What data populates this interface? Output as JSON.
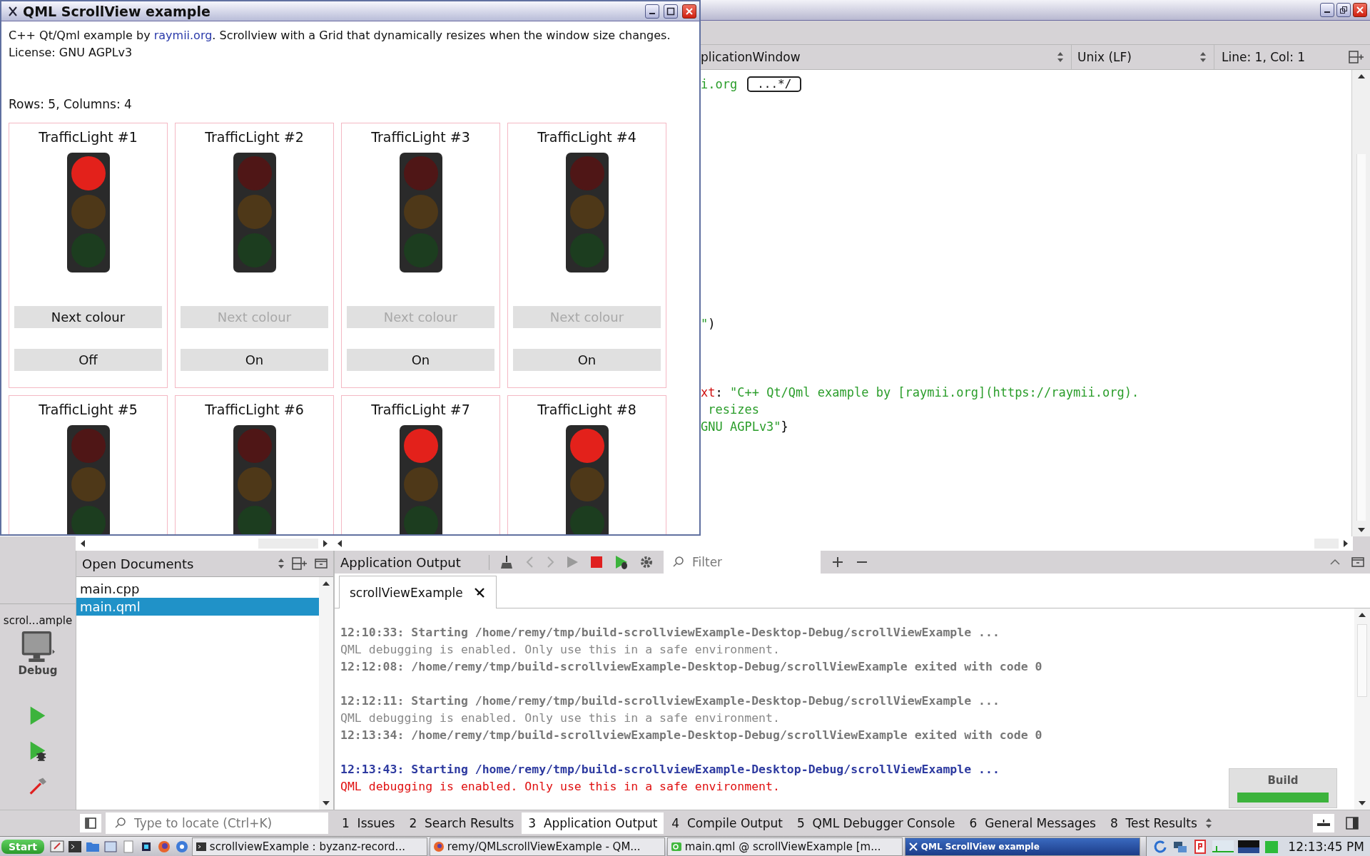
{
  "qml_window": {
    "title": "QML ScrollView example",
    "intro": {
      "before": "C++ Qt/Qml example by ",
      "link": "raymii.org",
      "after": ". Scrollview with a Grid that dynamically resizes when the window size changes."
    },
    "license": "License: GNU AGPLv3",
    "grid_info": "Rows: 5, Columns: 4",
    "lights": [
      {
        "title": "TrafficLight #1",
        "red_lit": true,
        "next_button": {
          "label": "Next colour",
          "disabled": false
        },
        "power_button": {
          "label": "Off"
        }
      },
      {
        "title": "TrafficLight #2",
        "red_lit": false,
        "next_button": {
          "label": "Next colour",
          "disabled": true
        },
        "power_button": {
          "label": "On"
        }
      },
      {
        "title": "TrafficLight #3",
        "red_lit": false,
        "next_button": {
          "label": "Next colour",
          "disabled": true
        },
        "power_button": {
          "label": "On"
        }
      },
      {
        "title": "TrafficLight #4",
        "red_lit": false,
        "next_button": {
          "label": "Next colour",
          "disabled": true
        },
        "power_button": {
          "label": "On"
        }
      },
      {
        "title": "TrafficLight #5",
        "red_lit": false
      },
      {
        "title": "TrafficLight #6",
        "red_lit": false
      },
      {
        "title": "TrafficLight #7",
        "red_lit": true
      },
      {
        "title": "TrafficLight #8",
        "red_lit": true
      }
    ]
  },
  "ide": {
    "editor_bar": {
      "document_type": "plicationWindow",
      "line_ending": "Unix (LF)",
      "cursor": "Line: 1, Col: 1"
    },
    "code_lines": [
      {
        "parts": [
          {
            "text": "i.org",
            "kind": "string"
          },
          {
            "text": "...*/",
            "kind": "fold"
          }
        ]
      },
      {
        "parts": [
          {
            "text": "\"",
            "kind": "string"
          },
          {
            "text": ")",
            "kind": "plain"
          }
        ]
      },
      {
        "parts": [
          {
            "text": "xt",
            "kind": "property"
          },
          {
            "text": ": ",
            "kind": "plain"
          },
          {
            "text": "\"C++ Qt/Qml example by [raymii.org](https://raymii.org).",
            "kind": "string"
          }
        ]
      },
      {
        "parts": [
          {
            "text": " resizes",
            "kind": "string"
          }
        ]
      },
      {
        "parts": [
          {
            "text": "GNU AGPLv3\"",
            "kind": "string"
          },
          {
            "text": "}",
            "kind": "plain"
          }
        ]
      }
    ],
    "mode_bar": {
      "target": "scrol...ample",
      "build_config": "Debug"
    },
    "open_documents": {
      "title": "Open Documents",
      "items": [
        {
          "name": "main.cpp",
          "selected": false
        },
        {
          "name": "main.qml",
          "selected": true
        }
      ]
    },
    "output_pane": {
      "title": "Application Output",
      "filter_placeholder": "Filter",
      "tabs": [
        {
          "label": "scrollViewExample",
          "selected": true
        }
      ],
      "runs": [
        {
          "lines": [
            {
              "text": "12:10:33: Starting /home/remy/tmp/build-scrollviewExample-Desktop-Debug/scrollViewExample ...",
              "kind": "info"
            },
            {
              "text": "QML debugging is enabled. Only use this in a safe environment.",
              "kind": "debug"
            },
            {
              "text": "12:12:08: /home/remy/tmp/build-scrollviewExample-Desktop-Debug/scrollViewExample exited with code 0",
              "kind": "info"
            }
          ]
        },
        {
          "lines": [
            {
              "text": "12:12:11: Starting /home/remy/tmp/build-scrollviewExample-Desktop-Debug/scrollViewExample ...",
              "kind": "info"
            },
            {
              "text": "QML debugging is enabled. Only use this in a safe environment.",
              "kind": "debug"
            },
            {
              "text": "12:13:34: /home/remy/tmp/build-scrollviewExample-Desktop-Debug/scrollViewExample exited with code 0",
              "kind": "info"
            }
          ]
        },
        {
          "lines": [
            {
              "text": "12:13:43: Starting /home/remy/tmp/build-scrollviewExample-Desktop-Debug/scrollViewExample ...",
              "kind": "current"
            },
            {
              "text": "QML debugging is enabled. Only use this in a safe environment.",
              "kind": "error"
            }
          ]
        }
      ]
    },
    "build": {
      "label": "Build",
      "level": 1
    },
    "locator_placeholder": "Type to locate (Ctrl+K)",
    "bottom_tabs": [
      {
        "number": "1",
        "label": "Issues",
        "selected": false
      },
      {
        "number": "2",
        "label": "Search Results",
        "selected": false
      },
      {
        "number": "3",
        "label": "Application Output",
        "selected": true
      },
      {
        "number": "4",
        "label": "Compile Output",
        "selected": false
      },
      {
        "number": "5",
        "label": "QML Debugger Console",
        "selected": false
      },
      {
        "number": "6",
        "label": "General Messages",
        "selected": false
      },
      {
        "number": "8",
        "label": "Test Results",
        "selected": false
      }
    ]
  },
  "taskbar": {
    "start": "Start",
    "tasks": [
      {
        "label": "scrollviewExample : byzanz-record...",
        "kind": "terminal",
        "selected": false
      },
      {
        "label": "remy/QMLscrollViewExample - QM...",
        "kind": "browser",
        "selected": false
      },
      {
        "label": "main.qml @ scrollViewExample [m...",
        "kind": "creator",
        "selected": false
      },
      {
        "label": "QML ScrollView example",
        "kind": "x",
        "selected": true
      }
    ],
    "clock": "12:13:45 PM"
  }
}
